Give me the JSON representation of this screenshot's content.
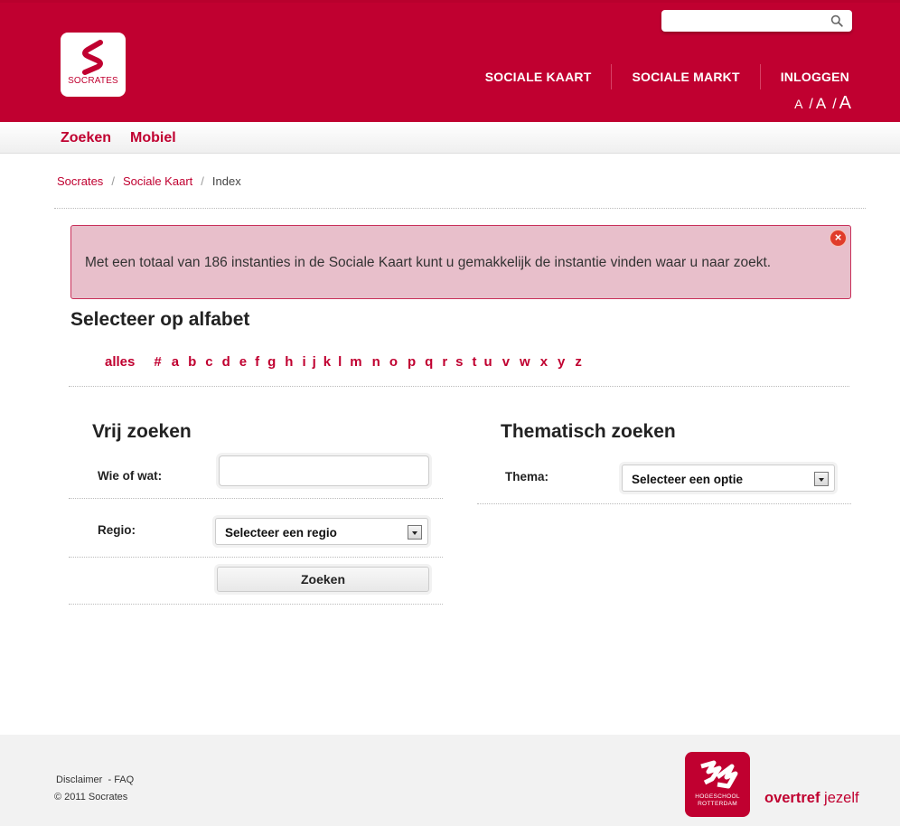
{
  "header": {
    "search": {
      "placeholder": "",
      "value": ""
    },
    "logo": {
      "text": "SOCRATES"
    },
    "nav": [
      "SOCIALE KAART",
      "SOCIALE MARKT",
      "INLOGGEN"
    ],
    "font_sizes": {
      "small": "A",
      "medium": "A",
      "large": "A"
    }
  },
  "subnav": {
    "items": [
      "Zoeken",
      "Mobiel"
    ]
  },
  "breadcrumb": {
    "items": [
      "Socrates",
      "Sociale Kaart"
    ],
    "current": "Index"
  },
  "alert": {
    "message": "Met een totaal van 186 instanties in de Sociale Kaart kunt u gemakkelijk de instantie vinden waar u naar zoekt.",
    "close": "×"
  },
  "alphabet": {
    "title": "Selecteer op alfabet",
    "letters": [
      "alles",
      "#",
      "a",
      "b",
      "c",
      "d",
      "e",
      "f",
      "g",
      "h",
      "i",
      "j",
      "k",
      "l",
      "m",
      "n",
      "o",
      "p",
      "q",
      "r",
      "s",
      "t",
      "u",
      "v",
      "w",
      "x",
      "y",
      "z"
    ]
  },
  "vrij_zoeken": {
    "title": "Vrij zoeken",
    "wie_label": "Wie of wat:",
    "wie_value": "",
    "regio_label": "Regio:",
    "regio_selected": "Selecteer een regio",
    "button": "Zoeken"
  },
  "thematisch_zoeken": {
    "title": "Thematisch zoeken",
    "thema_label": "Thema:",
    "thema_selected": "Selecteer een optie"
  },
  "footer": {
    "disclaimer": "Disclaimer",
    "faq": "- FAQ",
    "copyright": "© 2011 Socrates",
    "hr_logo_text_1": "HOGESCHOOL",
    "hr_logo_text_2": "ROTTERDAM",
    "tagline_bold": "overtref",
    "tagline_rest": "jezelf"
  },
  "colors": {
    "brand": "#c00030",
    "alert_bg": "#e8bfcb",
    "footer_bg": "#f2f2f2"
  }
}
